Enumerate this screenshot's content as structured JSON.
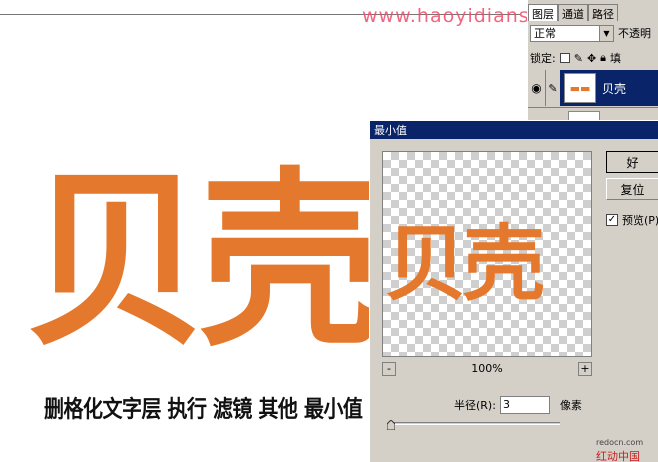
{
  "watermark": "www.haoyidianshe.com",
  "canvas": {
    "big_text": "贝壳",
    "instruction": "删格化文字层 执行 滤镜 其他 最小值 设置如图"
  },
  "layers_panel": {
    "tabs": [
      "图层",
      "通道",
      "路径"
    ],
    "blend_mode": "正常",
    "opacity_label": "不透明",
    "lock_label": "锁定:",
    "fill_label": "填",
    "layer_name": "贝壳"
  },
  "dialog": {
    "title": "最小值",
    "preview_text": "贝壳",
    "ok_label": "好",
    "reset_label": "复位",
    "preview_label": "预览(P)",
    "preview_checked": true,
    "zoom": "100%",
    "zoom_out": "-",
    "zoom_in": "+",
    "radius_label": "半径(R):",
    "radius_value": "3",
    "unit": "像素"
  },
  "footer": {
    "site": "redocn.com",
    "brand": "红动中国"
  },
  "colors": {
    "accent_orange": "#e4782c",
    "titlebar": "#0a246a",
    "watermark": "#f04a6a"
  }
}
